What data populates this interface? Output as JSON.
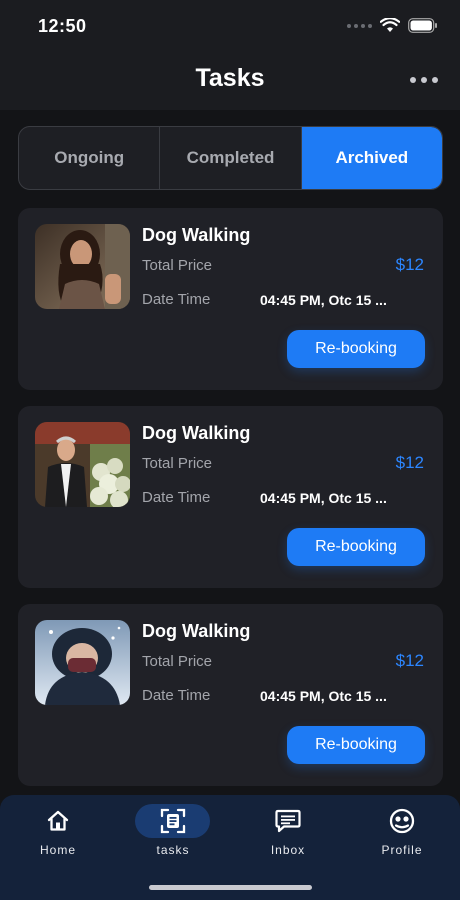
{
  "status_bar": {
    "time": "12:50"
  },
  "header": {
    "title": "Tasks"
  },
  "tabs": [
    {
      "label": "Ongoing",
      "active": false
    },
    {
      "label": "Completed",
      "active": false
    },
    {
      "label": "Archived",
      "active": true
    }
  ],
  "tasks": [
    {
      "title": "Dog Walking",
      "price_label": "Total Price",
      "price": "$12",
      "date_label": "Date Time",
      "date": "04:45 PM, Otc 15 ...",
      "button": "Re-booking"
    },
    {
      "title": "Dog Walking",
      "price_label": "Total Price",
      "price": "$12",
      "date_label": "Date Time",
      "date": "04:45 PM, Otc 15 ...",
      "button": "Re-booking"
    },
    {
      "title": "Dog Walking",
      "price_label": "Total Price",
      "price": "$12",
      "date_label": "Date Time",
      "date": "04:45 PM, Otc 15 ...",
      "button": "Re-booking"
    }
  ],
  "nav": [
    {
      "label": "Home",
      "icon": "home-icon"
    },
    {
      "label": "tasks",
      "icon": "tasks-icon",
      "active": true
    },
    {
      "label": "Inbox",
      "icon": "inbox-icon"
    },
    {
      "label": "Profile",
      "icon": "profile-icon"
    }
  ],
  "colors": {
    "accent": "#1e7bf5",
    "background": "#131417",
    "card": "#202127",
    "nav": "#14223a"
  }
}
